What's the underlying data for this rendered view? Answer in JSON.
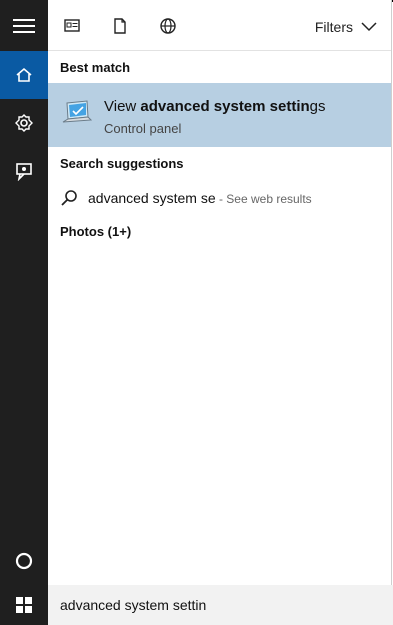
{
  "filters_label": "Filters",
  "sections": {
    "best_match": "Best match",
    "search_suggestions": "Search suggestions",
    "photos": "Photos (1+)"
  },
  "best_match_item": {
    "title_prefix": "View ",
    "title_bold": "advanced system settin",
    "title_suffix": "gs",
    "subtitle": "Control panel"
  },
  "suggestion": {
    "text": "advanced system se",
    "suffix": " - See web results"
  },
  "search_box": {
    "value": "advanced system settin"
  },
  "colors": {
    "rail_bg": "#1f1f1f",
    "rail_active": "#0a5aa3",
    "selected_row": "#b7cfe2"
  }
}
